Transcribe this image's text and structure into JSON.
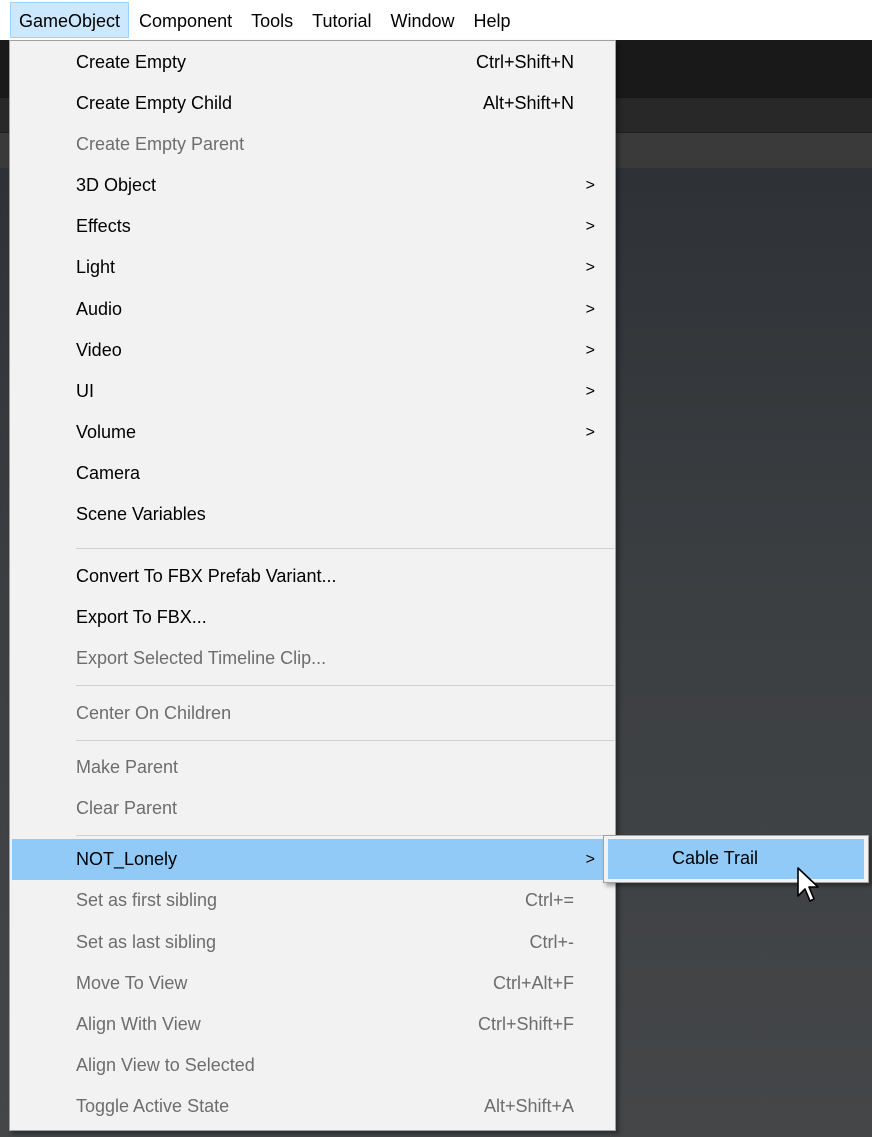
{
  "menubar": {
    "items": [
      {
        "label": "GameObject"
      },
      {
        "label": "Component"
      },
      {
        "label": "Tools"
      },
      {
        "label": "Tutorial"
      },
      {
        "label": "Window"
      },
      {
        "label": "Help"
      }
    ]
  },
  "gameobject_menu": {
    "create_empty": {
      "label": "Create Empty",
      "shortcut": "Ctrl+Shift+N"
    },
    "create_empty_child": {
      "label": "Create Empty Child",
      "shortcut": "Alt+Shift+N"
    },
    "create_empty_parent": {
      "label": "Create Empty Parent"
    },
    "object_3d": {
      "label": "3D Object",
      "arrow": ">"
    },
    "effects": {
      "label": "Effects",
      "arrow": ">"
    },
    "light": {
      "label": "Light",
      "arrow": ">"
    },
    "audio": {
      "label": "Audio",
      "arrow": ">"
    },
    "video": {
      "label": "Video",
      "arrow": ">"
    },
    "ui": {
      "label": "UI",
      "arrow": ">"
    },
    "volume": {
      "label": "Volume",
      "arrow": ">"
    },
    "camera": {
      "label": "Camera"
    },
    "scene_variables": {
      "label": "Scene Variables"
    },
    "convert_fbx": {
      "label": "Convert To FBX Prefab Variant..."
    },
    "export_fbx": {
      "label": "Export To FBX..."
    },
    "export_timeline": {
      "label": "Export Selected Timeline Clip..."
    },
    "center_children": {
      "label": "Center On Children"
    },
    "make_parent": {
      "label": "Make Parent"
    },
    "clear_parent": {
      "label": "Clear Parent"
    },
    "not_lonely": {
      "label": "NOT_Lonely",
      "arrow": ">"
    },
    "first_sibling": {
      "label": "Set as first sibling",
      "shortcut": "Ctrl+="
    },
    "last_sibling": {
      "label": "Set as last sibling",
      "shortcut": "Ctrl+-"
    },
    "move_to_view": {
      "label": "Move To View",
      "shortcut": "Ctrl+Alt+F"
    },
    "align_with_view": {
      "label": "Align With View",
      "shortcut": "Ctrl+Shift+F"
    },
    "align_view_selected": {
      "label": "Align View to Selected"
    },
    "toggle_active": {
      "label": "Toggle Active State",
      "shortcut": "Alt+Shift+A"
    }
  },
  "submenu": {
    "cable_trail": {
      "label": "Cable Trail"
    }
  },
  "colors": {
    "menu_bg": "#f2f2f2",
    "highlight": "#91c9f7",
    "menubar_active": "#cce8ff",
    "disabled_text": "#6d6d6d"
  }
}
